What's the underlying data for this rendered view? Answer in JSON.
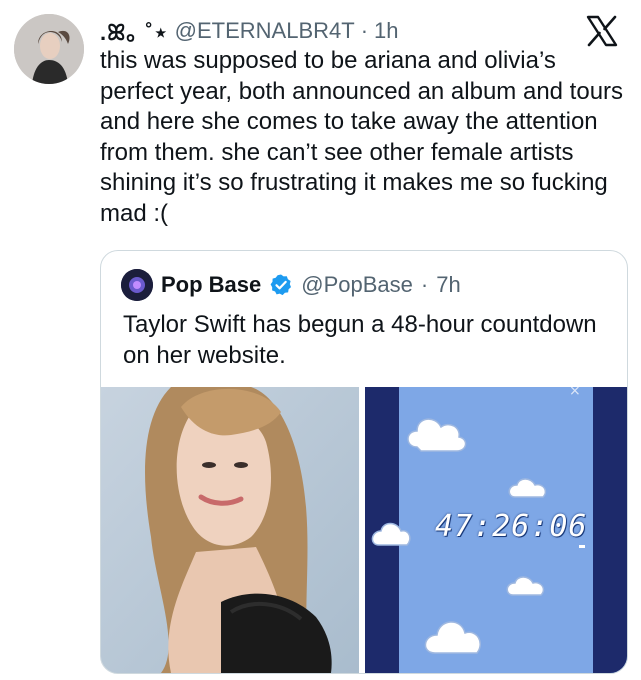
{
  "tweet": {
    "display_name": ".ꕤ｡ ˚⋆",
    "handle": "@ETERNALBR4T",
    "separator": "·",
    "time": "1h",
    "text": "this was supposed to be ariana and olivia’s perfect year, both announced an album and tours and here she comes to take away the attention from them. she can’t see other female artists shining it’s so frustrating it makes me so fucking mad :("
  },
  "quote": {
    "name": "Pop Base",
    "handle": "@PopBase",
    "separator": "·",
    "time": "7h",
    "text": "Taylor Swift has begun a 48-hour countdown on her website.",
    "countdown": "47:26:06",
    "close_mark": "×"
  },
  "colors": {
    "accent": "#1d9bf0",
    "secondary_text": "#536471",
    "border": "#cfd9de",
    "sky": "#7ea7e6"
  },
  "icons": [
    "x-logo-icon",
    "verified-badge-icon"
  ]
}
